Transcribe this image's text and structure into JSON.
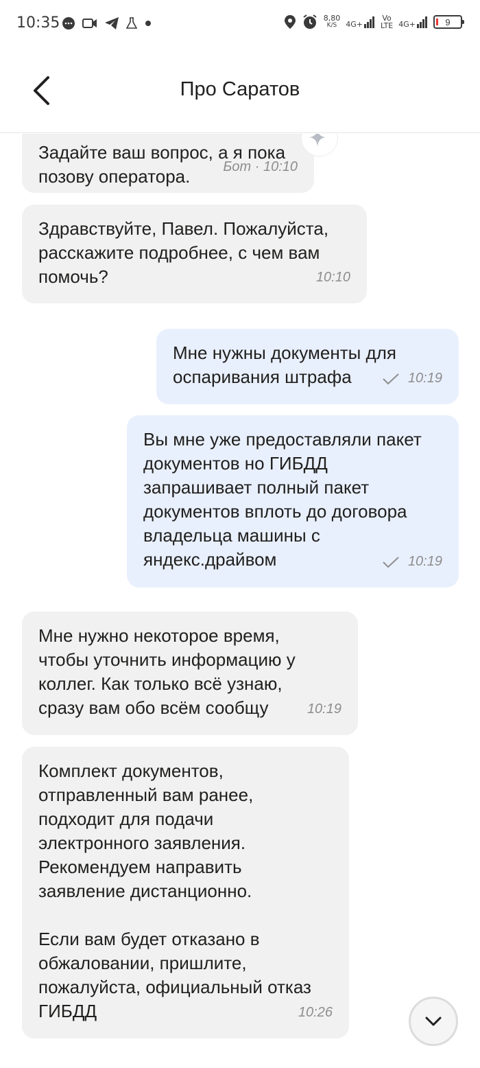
{
  "status_bar": {
    "time": "10:35",
    "net_speed_value": "8,80",
    "net_speed_unit": "K/S",
    "net1": "4G+",
    "volte_top": "Vo",
    "volte_bottom": "LTE",
    "net2": "4G+",
    "battery": "9"
  },
  "header": {
    "title": "Про Саратов"
  },
  "messages": [
    {
      "text": "Задайте ваш вопрос, а я пока\nпозову оператора.",
      "meta": "Бот · 10:10",
      "direction": "in"
    },
    {
      "text": "Здравствуйте, Павел. Пожалуйста,\nрасскажите подробнее, с чем вам\nпомочь?",
      "meta": "10:10",
      "direction": "in"
    },
    {
      "text": "Мне нужны документы для\nоспаривания штрафа",
      "meta": "10:19",
      "direction": "out"
    },
    {
      "text": "Вы мне уже предоставляли пакет\nдокументов но ГИБДД\nзапрашивает полный пакет\nдокументов вплоть до договора\nвладельца машины с\nяндекс.драйвом",
      "meta": "10:19",
      "direction": "out"
    },
    {
      "text": "Мне нужно некоторое время,\nчтобы уточнить информацию у\nколлег. Как только всё узнаю,\nсразу вам обо всём сообщу",
      "meta": "10:19",
      "direction": "in"
    },
    {
      "text": "Комплект документов,\nотправленный вам ранее,\nподходит для подачи\nэлектронного заявления.\nРекомендуем направить\nзаявление дистанционно.\n\nЕсли вам будет отказано в\nобжаловании, пришлите,\nпожалуйста, официальный отказ\nГИБДД",
      "meta": "10:26",
      "direction": "in"
    }
  ],
  "icons": {
    "back": "chevron-left-icon",
    "bot": "sparkle-icon",
    "read": "check-icon",
    "scroll": "chevron-down-icon"
  },
  "colors": {
    "incoming_bubble": "#f1f1f1",
    "outgoing_bubble": "#e9f0fd",
    "meta_text": "#8d8d8d"
  }
}
